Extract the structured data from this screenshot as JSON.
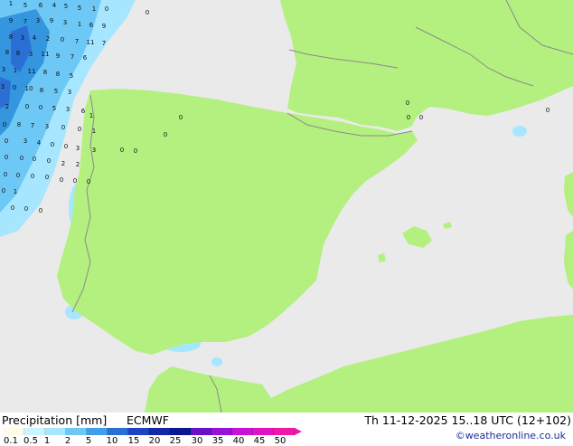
{
  "map": {
    "colors": {
      "sea": "#eaeaea",
      "land": "#b4f080",
      "border": "#8a8a8a",
      "precip_light": "#a6e6ff",
      "precip_mid": "#6ec8f5",
      "precip_heavy": "#3596e0",
      "precip_max": "#2a6fd4"
    },
    "values": [
      "1",
      "5",
      "6",
      "4",
      "5",
      "5",
      "1",
      "0",
      "0",
      "9",
      "7",
      "3",
      "9",
      "3",
      "1",
      "6",
      "9",
      "8",
      "3",
      "4",
      "2",
      "0",
      "7",
      "11",
      "7",
      "8",
      "8",
      "3",
      "11",
      "9",
      "7",
      "6",
      "3",
      "1",
      "11",
      "8",
      "8",
      "5",
      "3",
      "0",
      "10",
      "8",
      "5",
      "3",
      "2",
      "0",
      "0",
      "5",
      "3",
      "6",
      "1",
      "0",
      "8",
      "7",
      "3",
      "0",
      "0",
      "1",
      "0",
      "3",
      "4",
      "0",
      "0",
      "3",
      "3",
      "0",
      "0",
      "0",
      "0",
      "2",
      "2",
      "0",
      "0",
      "0",
      "0",
      "0",
      "0",
      "0",
      "0",
      "1",
      "0",
      "0",
      "0",
      "0",
      "0",
      "0",
      "0",
      "0",
      "0",
      "0",
      "0",
      "1"
    ]
  },
  "footer": {
    "title": "Precipitation [mm]",
    "model": "ECMWF",
    "datetime": "Th 11-12-2025 15..18 UTC (12+102)",
    "credit": "©weatheronline.co.uk",
    "legend_ticks": [
      "0.1",
      "0.5",
      "1",
      "2",
      "5",
      "10",
      "15",
      "20",
      "25",
      "30",
      "35",
      "40",
      "45",
      "50"
    ],
    "legend_colors": [
      "#fffbe6",
      "#c8f5ff",
      "#a6e6ff",
      "#6ec8f5",
      "#3f9fe8",
      "#2a6fd4",
      "#1c44c2",
      "#1228a8",
      "#0a1890",
      "#6a10c8",
      "#9a10d8",
      "#c812d8",
      "#e014c0",
      "#f018a8"
    ]
  }
}
